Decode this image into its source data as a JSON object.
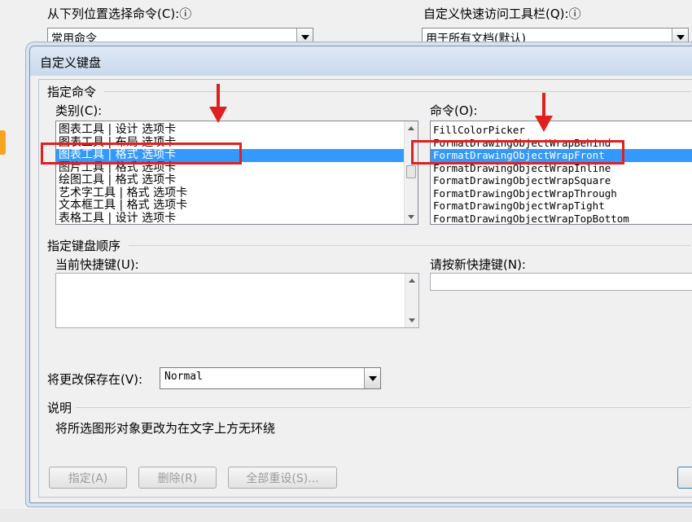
{
  "background": {
    "label_from": "从下列位置选择命令(C):ⓘ",
    "combo_from_value": "常用命令",
    "label_toolbar": "自定义快速访问工具栏(Q):ⓘ",
    "combo_toolbar_value": "用于所有文档(默认)"
  },
  "dialog": {
    "title": "自定义键盘",
    "section_commands": "指定命令",
    "categories_label": "类别(C):",
    "categories": [
      "图表工具 | 设计 选项卡",
      "图表工具 | 布局 选项卡",
      "图表工具 | 格式 选项卡",
      "图片工具 | 格式 选项卡",
      "绘图工具 | 格式 选项卡",
      "艺术字工具 | 格式 选项卡",
      "文本框工具 | 格式 选项卡",
      "表格工具 | 设计 选项卡"
    ],
    "commands_label": "命令(O):",
    "commands": [
      "FillColorPicker",
      "FormatDrawingObjectWrapBehind",
      "FormatDrawingObjectWrapFront",
      "FormatDrawingObjectWrapInline",
      "FormatDrawingObjectWrapSquare",
      "FormatDrawingObjectWrapThrough",
      "FormatDrawingObjectWrapTight",
      "FormatDrawingObjectWrapTopBottom"
    ],
    "section_keys": "指定键盘顺序",
    "current_keys_label": "当前快捷键(U):",
    "new_key_label": "请按新快捷键(N):",
    "save_in_label": "将更改保存在(V):",
    "save_in_value": "Normal",
    "description_header": "说明",
    "description_text": "将所选图形对象更改为在文字上方无环绕",
    "buttons": {
      "assign": "指定(A)",
      "remove": "删除(R)",
      "reset_all": "全部重设(S)..."
    }
  },
  "colors": {
    "selection": "#3399ff",
    "annotation_red": "#e02020"
  }
}
